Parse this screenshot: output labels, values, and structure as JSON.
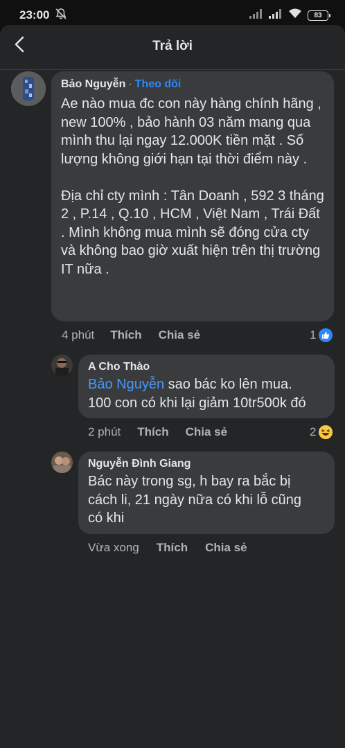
{
  "status_bar": {
    "time": "23:00",
    "battery": "83"
  },
  "header": {
    "title": "Trả lời",
    "back_icon": "chevron-left-icon"
  },
  "comments": [
    {
      "author": "Bảo Nguyễn",
      "follow_separator": "·",
      "follow_label": "Theo dõi",
      "text": "Ae nào mua đc con này hàng chính hãng , new 100% , bảo hành 03 năm mang qua mình thu lại ngay 12.000K tiền mặt . Số lượng không giới hạn tại thời điểm này .\n\nĐịa chỉ cty mình : Tân Doanh , 592 3 tháng 2 , P.14 , Q.10 , HCM , Việt Nam , Trái Đất . Mình không mua mình sẽ đóng cửa cty và không bao giờ xuất hiện trên thị trường IT nữa .",
      "time": "4 phút",
      "like_label": "Thích",
      "share_label": "Chia sẻ",
      "reaction_count": "1",
      "reaction_icon": "like-icon"
    },
    {
      "author": "A Cho Thào",
      "mention": "Bảo Nguyễn",
      "text": " sao bác ko lên mua.\n100 con có khi lại giảm 10tr500k đó",
      "time": "2 phút",
      "like_label": "Thích",
      "share_label": "Chia sẻ",
      "reaction_count": "2",
      "reaction_icon": "haha-icon"
    },
    {
      "author": "Nguyễn Đình Giang",
      "text": "Bác này trong sg, h bay ra bắc bị\ncách li, 21 ngày nữa có khi lỗ cũng\ncó khi",
      "time": "Vừa xong",
      "like_label": "Thích",
      "share_label": "Chia sẻ"
    }
  ],
  "colors": {
    "background": "#242526",
    "bubble": "#3a3b3c",
    "link": "#2d88ff",
    "secondary_text": "#b0b3b8"
  }
}
